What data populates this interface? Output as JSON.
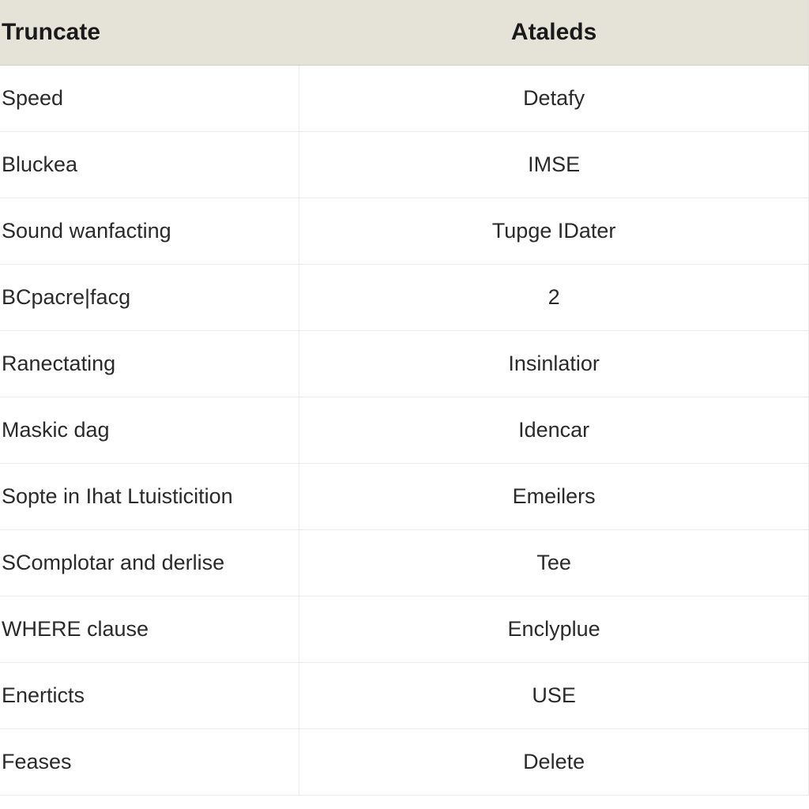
{
  "table": {
    "headers": {
      "col1": "Truncate",
      "col2": "Ataleds"
    },
    "rows": [
      {
        "col1": "Speed",
        "col2": "Detafy"
      },
      {
        "col1": "Bluckea",
        "col2": "IMSE"
      },
      {
        "col1": "Sound wanfacting",
        "col2": "Tupge IDater"
      },
      {
        "col1": "BCpacre|facg",
        "col2": "2"
      },
      {
        "col1": "Ranectating",
        "col2": "Insinlatior"
      },
      {
        "col1": "Maskic dag",
        "col2": "Idencar"
      },
      {
        "col1": "Sopte in Ihat Ltuisticition",
        "col2": "Emeilers"
      },
      {
        "col1": "SComplotar and derlise",
        "col2": "Tee"
      },
      {
        "col1": "WHERE clause",
        "col2": "Enclyplue"
      },
      {
        "col1": "Enerticts",
        "col2": "USE"
      },
      {
        "col1": "Feases",
        "col2": "Delete"
      }
    ]
  }
}
